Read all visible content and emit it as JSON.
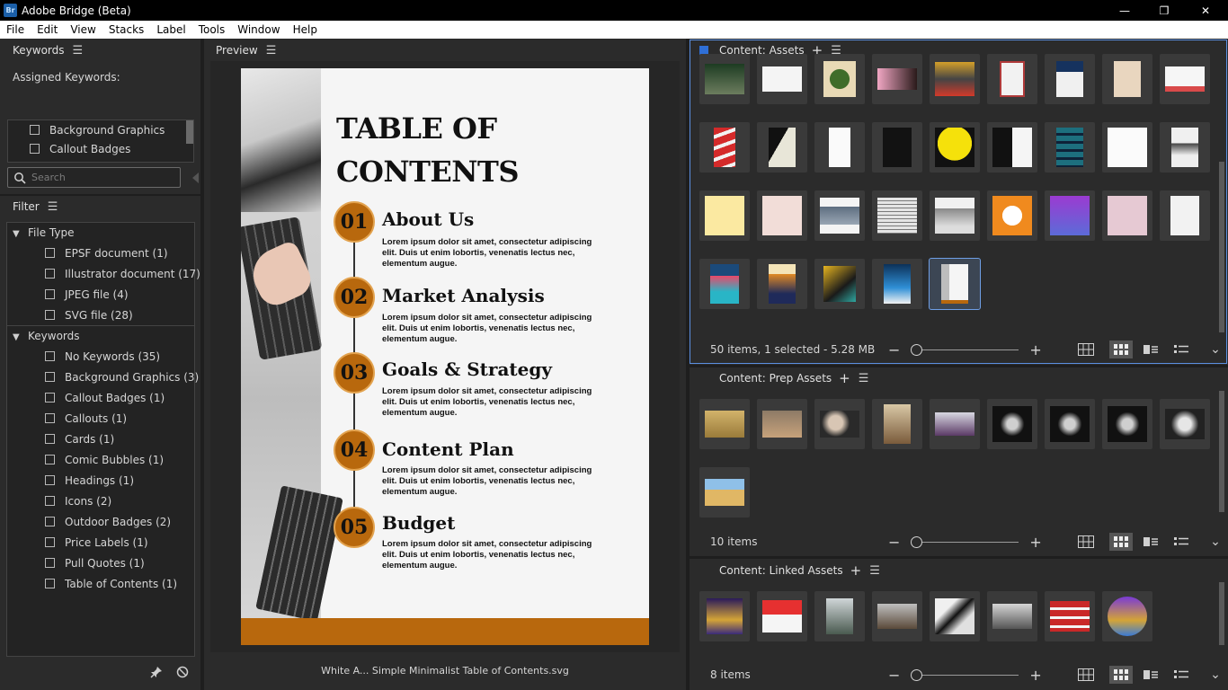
{
  "window": {
    "title": "Adobe Bridge (Beta)",
    "logo": "Br",
    "minimize": "—",
    "restore": "❐",
    "close": "✕"
  },
  "menu": [
    "File",
    "Edit",
    "View",
    "Stacks",
    "Label",
    "Tools",
    "Window",
    "Help"
  ],
  "keywords_panel": {
    "title": "Keywords",
    "assigned_label": "Assigned Keywords:",
    "list": [
      "Background Graphics",
      "Callout Badges"
    ],
    "search_placeholder": "Search"
  },
  "filter_panel": {
    "title": "Filter",
    "groups": [
      {
        "label": "File Type",
        "items": [
          "EPSF document  (1)",
          "Illustrator document  (17)",
          "JPEG file  (4)",
          "SVG file  (28)"
        ]
      },
      {
        "label": "Keywords",
        "items": [
          "No Keywords  (35)",
          "Background Graphics  (3)",
          "Callout Badges  (1)",
          "Callouts  (1)",
          "Cards  (1)",
          "Comic Bubbles  (1)",
          "Headings  (1)",
          "Icons  (2)",
          "Outdoor Badges  (2)",
          "Price Labels  (1)",
          "Pull Quotes  (1)",
          "Table of Contents  (1)"
        ]
      }
    ]
  },
  "preview": {
    "title": "Preview",
    "filename": "White A... Simple Minimalist Table of Contents.svg",
    "doc": {
      "heading_line1": "TABLE OF",
      "heading_line2": "CONTENTS",
      "body": "Lorem ipsum dolor sit amet, consectetur adipiscing elit. Duis ut enim lobortis, venenatis lectus nec, elementum augue.",
      "items": [
        {
          "num": "01",
          "title": "About Us"
        },
        {
          "num": "02",
          "title": "Market Analysis"
        },
        {
          "num": "03",
          "title": "Goals & Strategy"
        },
        {
          "num": "04",
          "title": "Content Plan"
        },
        {
          "num": "05",
          "title": "Budget"
        }
      ],
      "accent": "#b8680d"
    }
  },
  "content_assets": {
    "title": "Content: Assets",
    "status": "50 items, 1 selected - 5.28 MB"
  },
  "content_prep": {
    "title": "Content: Prep Assets",
    "status": "10 items"
  },
  "content_linked": {
    "title": "Content: Linked Assets",
    "status": "8 items"
  },
  "icons": {
    "add": "+",
    "minus": "−",
    "plus": "+",
    "chevron": "⌄",
    "menu": "☰"
  },
  "colors": {
    "panel_bg": "#2b2b2b",
    "active_outline": "#5b8fe0",
    "accent": "#b8680d"
  }
}
